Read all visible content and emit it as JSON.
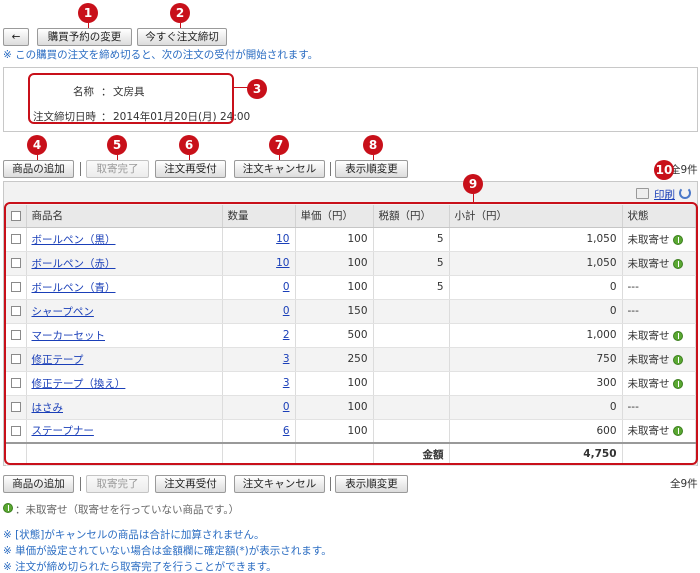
{
  "toolbar_top": {
    "back_glyph": "←",
    "change_label": "購買予約の変更",
    "close_now_label": "今すぐ注文締切"
  },
  "top_note": "※ この購買の注文を締め切ると、次の注文の受付が開始されます。",
  "info": {
    "name_label": "名称",
    "name_value": "文房具",
    "deadline_label": "注文締切日時",
    "deadline_value": "2014年01月20日(月) 24:00",
    "sep": "："
  },
  "action_buttons": {
    "add": "商品の追加",
    "complete": "取寄完了",
    "reaccept": "注文再受付",
    "cancel": "注文キャンセル",
    "reorder": "表示順変更"
  },
  "count_label": "全9件",
  "print_label": "印刷",
  "table": {
    "headers": [
      "商品名",
      "数量",
      "単価（円）",
      "税額（円）",
      "小計（円）",
      "状態"
    ],
    "rows": [
      {
        "name": "ボールペン（黒）",
        "qty": "10",
        "price": "100",
        "tax": "5",
        "subtotal": "1,050",
        "status": "未取寄せ"
      },
      {
        "name": "ボールペン（赤）",
        "qty": "10",
        "price": "100",
        "tax": "5",
        "subtotal": "1,050",
        "status": "未取寄せ"
      },
      {
        "name": "ボールペン（青）",
        "qty": "0",
        "price": "100",
        "tax": "5",
        "subtotal": "0",
        "status": "---"
      },
      {
        "name": "シャープペン",
        "qty": "0",
        "price": "150",
        "tax": "",
        "subtotal": "0",
        "status": "---"
      },
      {
        "name": "マーカーセット",
        "qty": "2",
        "price": "500",
        "tax": "",
        "subtotal": "1,000",
        "status": "未取寄せ"
      },
      {
        "name": "修正テープ",
        "qty": "3",
        "price": "250",
        "tax": "",
        "subtotal": "750",
        "status": "未取寄せ"
      },
      {
        "name": "修正テープ（換え）",
        "qty": "3",
        "price": "100",
        "tax": "",
        "subtotal": "300",
        "status": "未取寄せ"
      },
      {
        "name": "はさみ",
        "qty": "0",
        "price": "100",
        "tax": "",
        "subtotal": "0",
        "status": "---"
      },
      {
        "name": "ステープナー",
        "qty": "6",
        "price": "100",
        "tax": "",
        "subtotal": "600",
        "status": "未取寄せ"
      }
    ],
    "total_label": "金額",
    "total_value": "4,750"
  },
  "legend": "：未取寄せ（取寄せを行っていない商品です。）",
  "notes": [
    "※ [状態]がキャンセルの商品は合計に加算されません。",
    "※ 単価が設定されていない場合は金額欄に確定額(*)が表示されます。",
    "※ 注文が締め切られたら取寄完了を行うことができます。"
  ],
  "callouts": [
    "1",
    "2",
    "3",
    "4",
    "5",
    "6",
    "7",
    "8",
    "9",
    "10"
  ],
  "colors": {
    "callout": "#c8101a",
    "link": "#1a3fb8",
    "note": "#2a6cc2",
    "status_icon": "#5aa832"
  }
}
